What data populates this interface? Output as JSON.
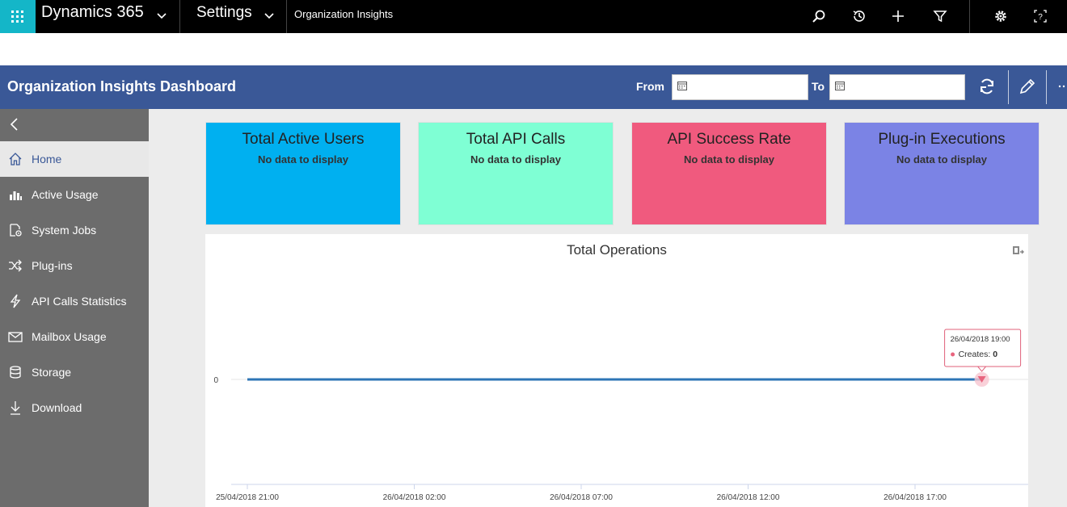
{
  "topnav": {
    "app_name": "Dynamics 365",
    "area": "Settings",
    "breadcrumb": "Organization Insights",
    "icons": [
      "app-launcher-icon",
      "search-icon",
      "history-icon",
      "plus-icon",
      "filter-icon",
      "gear-icon",
      "help-icon"
    ]
  },
  "header": {
    "title": "Organization Insights Dashboard",
    "from_label": "From",
    "to_label": "To",
    "from_value": "",
    "to_value": "",
    "bg_color": "#3a5897"
  },
  "sidebar": {
    "items": [
      {
        "label": "Home",
        "icon": "home-icon",
        "active": true
      },
      {
        "label": "Active Usage",
        "icon": "bar-chart-icon",
        "active": false
      },
      {
        "label": "System Jobs",
        "icon": "system-jobs-icon",
        "active": false
      },
      {
        "label": "Plug-ins",
        "icon": "shuffle-icon",
        "active": false
      },
      {
        "label": "API Calls Statistics",
        "icon": "lightning-icon",
        "active": false
      },
      {
        "label": "Mailbox Usage",
        "icon": "mail-icon",
        "active": false
      },
      {
        "label": "Storage",
        "icon": "database-icon",
        "active": false
      },
      {
        "label": "Download",
        "icon": "download-icon",
        "active": false
      }
    ]
  },
  "tiles": [
    {
      "title": "Total Active Users",
      "value": "No data to display",
      "color": "#00b0f0"
    },
    {
      "title": "Total API Calls",
      "value": "No data to display",
      "color": "#7fffd4"
    },
    {
      "title": "API Success Rate",
      "value": "No data to display",
      "color": "#f05a7e"
    },
    {
      "title": "Plug-in Executions",
      "value": "No data to display",
      "color": "#7b83e5"
    }
  ],
  "chart_data": {
    "type": "line",
    "title": "Total Operations",
    "x": [
      "25/04/2018 21:00",
      "26/04/2018 19:00"
    ],
    "x_ticks": [
      "25/04/2018 21:00",
      "26/04/2018 02:00",
      "26/04/2018 07:00",
      "26/04/2018 12:00",
      "26/04/2018 17:00"
    ],
    "y_ticks": [
      "0"
    ],
    "series": [
      {
        "name": "Creates",
        "values": [
          0,
          0
        ],
        "color": "#2e75b6"
      }
    ],
    "tooltip": {
      "time": "26/04/2018 19:00",
      "series": "Creates",
      "value": "0"
    }
  }
}
